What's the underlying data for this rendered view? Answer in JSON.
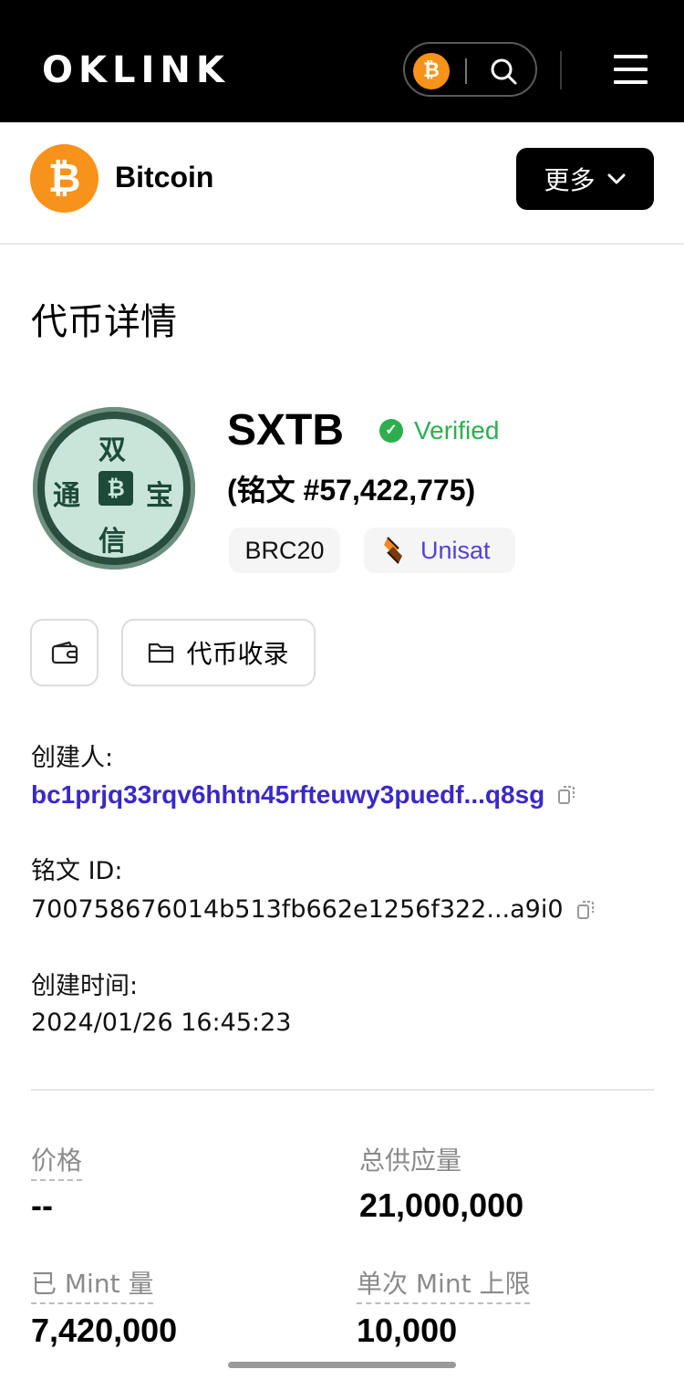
{
  "header": {
    "logo_letters": [
      "O",
      "K",
      "L",
      "I",
      "N",
      "K"
    ],
    "icons": {
      "chain": "bitcoin-icon",
      "search": "search-icon",
      "menu": "hamburger-menu-icon"
    }
  },
  "chain": {
    "name": "Bitcoin",
    "logo_glyph": "₿",
    "more_label": "更多"
  },
  "section_title": "代币详情",
  "token": {
    "ticker": "SXTB",
    "verified_label": "Verified",
    "inscription": "(铭文 #57,422,775)",
    "tags": {
      "standard": "BRC20",
      "marketplace": "Unisat"
    },
    "logo_chars": {
      "top": "双",
      "left": "通",
      "right": "宝",
      "bottom": "信",
      "center": "₿"
    }
  },
  "actions": {
    "collection_label": "代币收录"
  },
  "info": {
    "creator_label": "创建人:",
    "creator_value": "bc1prjq33rqv6hhtn45rfteuwy3puedf...q8sg",
    "inscription_id_label": "铭文 ID:",
    "inscription_id_value": "700758676014b513fb662e1256f322...a9i0",
    "created_label": "创建时间:",
    "created_value": "2024/01/26 16:45:23"
  },
  "stats": {
    "price_label": "价格",
    "price_value": "--",
    "supply_label": "总供应量",
    "supply_value": "21,000,000",
    "minted_label": "已 Mint 量",
    "minted_value": "7,420,000",
    "limit_label": "单次 Mint 上限",
    "limit_value": "10,000"
  },
  "colors": {
    "accent_link": "#3b28c9",
    "verified": "#2dae4f",
    "bitcoin": "#f7931a"
  }
}
